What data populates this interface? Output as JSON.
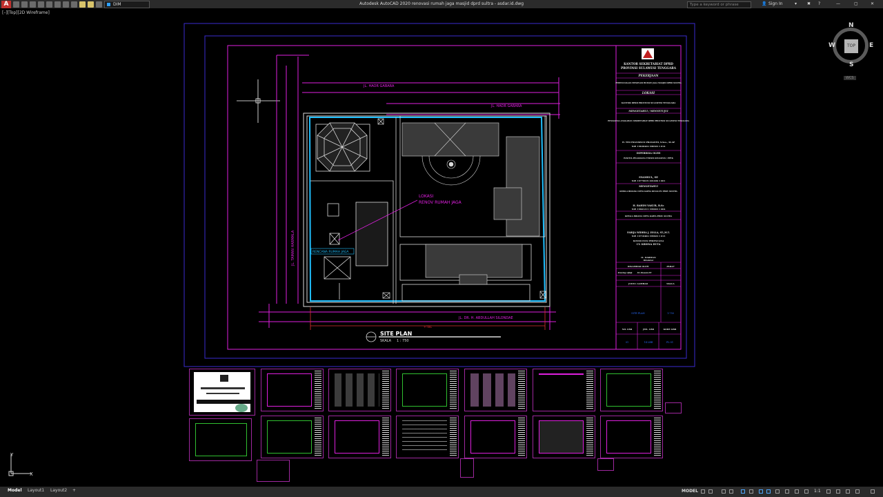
{
  "window": {
    "title": "Autodesk AutoCAD 2020    renovasi rumah jaga masjid dprd sultra - asdar.id.dwg",
    "app_letter": "A",
    "search_placeholder": "Type a keyword or phrase",
    "sign_in": "Sign In",
    "layer_name": "DIM"
  },
  "viewport_label": "[–][Top][2D Wireframe]",
  "viewcube": {
    "top": "TOP",
    "n": "N",
    "s": "S",
    "e": "E",
    "w": "W",
    "wcs": "WCS"
  },
  "drawing": {
    "street_top": "JL. HAOR GABARA",
    "street_top2": "JL. HAOR GABARA",
    "street_left": "JL. TAMAN HARMALA",
    "street_bottom": "JL. DR. H. ABDULLAH SILONDAE",
    "location_label": "LOKASI",
    "location_label2": "RENOV RUMAH JAGA",
    "plan_label": "RENCANA RUMAH JAGA",
    "dimension": "+TBL",
    "site_plan_title": "SITE PLAN",
    "site_plan_scale_label": "SKALA",
    "site_plan_scale": "1 : 750"
  },
  "title_block": {
    "office": "KANTOR SEKRETARIAT DPRD",
    "province": "PROVINSI SULAWESI TENGGARA",
    "pekerjaan_label": "PEKERJAAN",
    "pekerjaan": "PERENCANAAN RENOVASI RUMAH JAGA MASJID DPRD SULTRA",
    "lokasi_label": "LOKASI",
    "lokasi": "KANTOR DPRD PROVINSI SULAWESI TENGGARA",
    "mengetahui1": "MENGETAHUI / MENYETUJUI",
    "pengguna": "PENGGUNA ANGGARAN SEKRETARIAT DPRD PROVINSI SULAWESI TENGGARA",
    "name1": "H. TEO FRANSISCO PRASASTO, S.Sos., M.AP",
    "nip1": "NIP. 19630424 198303 1 014",
    "diperiksa": "DIPERIKSA OLEH",
    "panitia": "PANITIA PELAKSANA TEKNIS KEGIATAN / PPTK",
    "name2": "SYAMSUL, SE",
    "nip2": "NIP. 19770619 201406 1 001",
    "mengetahui2": "MENGETAHUI",
    "kepala": "KEPALA BIDANG CIPTA KARYA DINAS PU PROV SULTRA",
    "name3": "H. RAHIM YAKUB, B.Sc",
    "nip3": "NIP. 19661211 199003 1 004",
    "kepala2": "KEPALA BIDANG CIPTA KARYA PROV. SULTRA",
    "name4": "FARIJA WIDHIA J. ZOLLA, ST.,M.T.",
    "nip4": "NIP. 19710404 199603 1 013",
    "konsultan": "KONSULTAN PERENCANA",
    "cv": "CV. KRISNA DUTA",
    "director_name": "IL. DARMAN",
    "director_title": "Direktur",
    "digambar": "DIGAMBAR OLEH",
    "paraf": "PARAF",
    "drafter_label": "drawing sijinji",
    "drafter": "AS Abasam.ST",
    "judul": "JUDUL GAMBAR",
    "skala": "SKALA",
    "judul_value": "SITE PLAN",
    "skala_value": "1:750",
    "no_lbr": "NO. LBR",
    "jml_lbr": "JML. LBR",
    "kode": "KODE GBR",
    "no_lbr_v": "01",
    "jml_lbr_v": "14 LBR",
    "kode_v": "PL-01"
  },
  "status_bar": {
    "tabs": [
      "Model",
      "Layout1",
      "Layout2"
    ],
    "add_tab": "+",
    "model": "MODEL",
    "scale": "1:1"
  },
  "colors": {
    "magenta": "#e020e0",
    "purple_frame": "#3a2bd0",
    "cyan": "#20c0ff",
    "red": "#e03030",
    "white": "#dcdcdc"
  }
}
